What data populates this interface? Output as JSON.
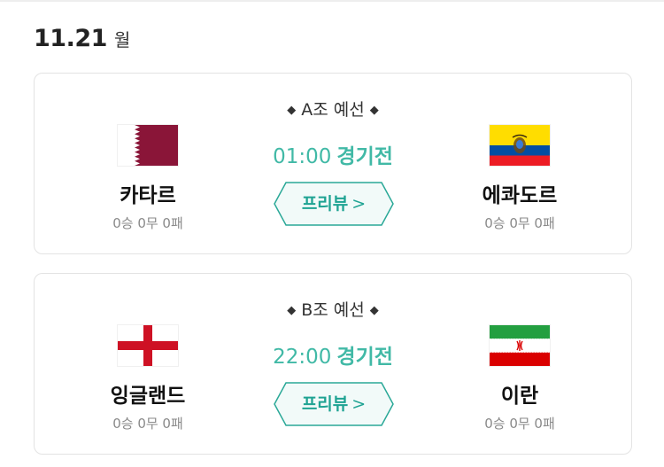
{
  "date": {
    "number": "11.21",
    "weekday": "월"
  },
  "matches": [
    {
      "group": "A조 예선",
      "time": "01:00",
      "status": "경기전",
      "preview_label": "프리뷰",
      "home": {
        "name": "카타르",
        "record": "0승 0무 0패",
        "flag_icon": "qatar-flag-icon"
      },
      "away": {
        "name": "에콰도르",
        "record": "0승 0무 0패",
        "flag_icon": "ecuador-flag-icon"
      }
    },
    {
      "group": "B조 예선",
      "time": "22:00",
      "status": "경기전",
      "preview_label": "프리뷰",
      "home": {
        "name": "잉글랜드",
        "record": "0승 0무 0패",
        "flag_icon": "england-flag-icon"
      },
      "away": {
        "name": "이란",
        "record": "0승 0무 0패",
        "flag_icon": "iran-flag-icon"
      }
    }
  ],
  "colors": {
    "accent_teal": "#41b9a6",
    "button_border": "#2aa897",
    "button_fill": "#f2faf9",
    "qatar_maroon": "#8a1538",
    "ecuador_yellow": "#ffdd00",
    "ecuador_blue": "#034ea2",
    "ecuador_red": "#ed1c24",
    "england_red": "#ce1124",
    "iran_green": "#239f40",
    "iran_red": "#da0000"
  }
}
